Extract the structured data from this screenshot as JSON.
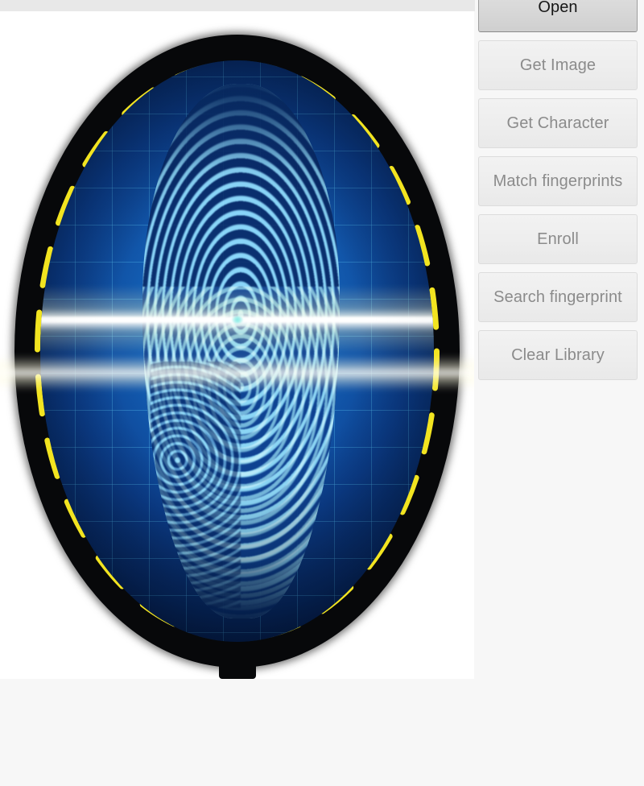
{
  "app": {
    "background_color": "#f7f7f7",
    "status_strip_color": "#e8e8e8"
  },
  "image_panel": {
    "name": "fingerprint-preview",
    "background_color": "#ffffff",
    "graphic": {
      "description": "fingerprint-scan-illustration",
      "bezel_color": "#07080a",
      "ring_glow_color": "#29dcf7",
      "dash_color": "#f2e420",
      "screen_color_light": "#1f7fd4",
      "screen_color_dark": "#031636",
      "ridge_color": "#96e1ff",
      "grid_color": "#5ac3f0",
      "scan_beam_color": "#ffffff",
      "scan_center_dot_color": "#7fe9e2",
      "dash_count": 24
    }
  },
  "buttons": [
    {
      "label": "Open",
      "name": "open-button",
      "state": "enabled"
    },
    {
      "label": "Get Image",
      "name": "get-image-button",
      "state": "disabled"
    },
    {
      "label": "Get Character",
      "name": "get-character-button",
      "state": "disabled"
    },
    {
      "label": "Match fingerprints",
      "name": "match-fingerprints-button",
      "state": "disabled"
    },
    {
      "label": "Enroll",
      "name": "enroll-button",
      "state": "disabled"
    },
    {
      "label": "Search fingerprint",
      "name": "search-fingerprint-button",
      "state": "disabled"
    },
    {
      "label": "Clear Library",
      "name": "clear-library-button",
      "state": "disabled"
    }
  ]
}
